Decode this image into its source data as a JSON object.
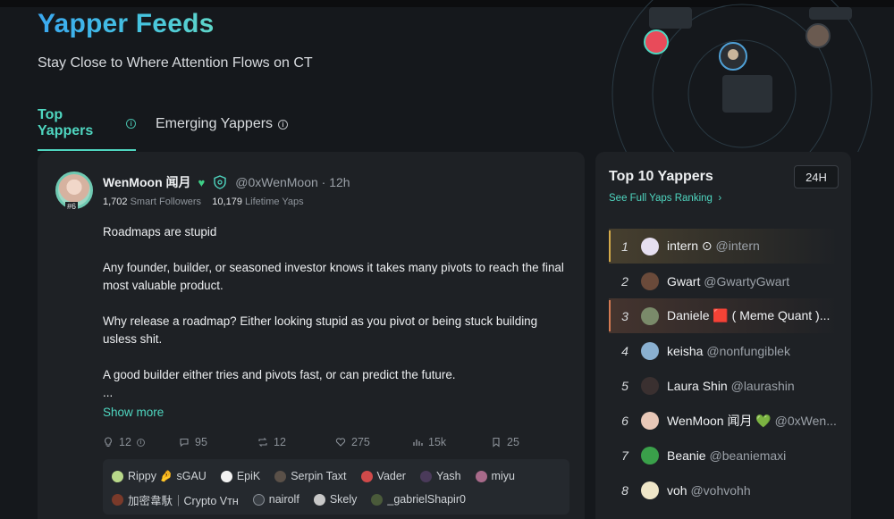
{
  "header": {
    "title": "Yapper Feeds",
    "subtitle": "Stay Close to Where Attention Flows on CT"
  },
  "tabs": [
    {
      "label": "Top Yappers",
      "active": true
    },
    {
      "label": "Emerging Yappers",
      "active": false
    }
  ],
  "post": {
    "rank": "#6",
    "author": "WenMoon 闻月",
    "handle_time": "@0xWenMoon · 12h",
    "smart_followers_value": "1,702",
    "smart_followers_label": "Smart Followers",
    "lifetime_yaps_value": "10,179",
    "lifetime_yaps_label": "Lifetime Yaps",
    "body": [
      "Roadmaps are stupid",
      "Any founder, builder, or seasoned investor knows it takes many pivots to reach the final most valuable product.",
      "Why release a roadmap? Either looking stupid as you pivot or being stuck building usless shit.",
      "A good builder either tries and pivots fast, or can predict the future.",
      "..."
    ],
    "show_more": "Show more",
    "actions": {
      "smart_engagement": "12",
      "replies": "95",
      "reposts": "12",
      "likes": "275",
      "views": "15k",
      "bookmarks": "25"
    },
    "likers_row1": [
      "Rippy 🤌 sGAU",
      "EpiK",
      "Serpin Taxt",
      "Vader",
      "Yash",
      "miyu"
    ],
    "likers_row2": [
      "加密韋馱｜Crypto Vᴛʜ",
      "nairolf",
      "Skely",
      "_gabrielShapir0"
    ]
  },
  "sidebar": {
    "title": "Top 10 Yappers",
    "link": "See Full Yaps Ranking",
    "period": "24H",
    "rankings": [
      {
        "rank": "1",
        "name": "intern ⊙",
        "handle": "@intern"
      },
      {
        "rank": "2",
        "name": "Gwart",
        "handle": "@GwartyGwart"
      },
      {
        "rank": "3",
        "name": "Daniele 🟥 ( Meme Quant )...",
        "handle": ""
      },
      {
        "rank": "4",
        "name": "keisha",
        "handle": "@nonfungiblek"
      },
      {
        "rank": "5",
        "name": "Laura Shin",
        "handle": "@laurashin"
      },
      {
        "rank": "6",
        "name": "WenMoon 闻月 💚",
        "handle": "@0xWen..."
      },
      {
        "rank": "7",
        "name": "Beanie",
        "handle": "@beaniemaxi"
      },
      {
        "rank": "8",
        "name": "voh",
        "handle": "@vohvohh"
      }
    ]
  },
  "colors": {
    "accent": "#4fd6c0",
    "background": "#15181c",
    "card": "#1e2125",
    "verified_heart": "#3ecf87"
  }
}
